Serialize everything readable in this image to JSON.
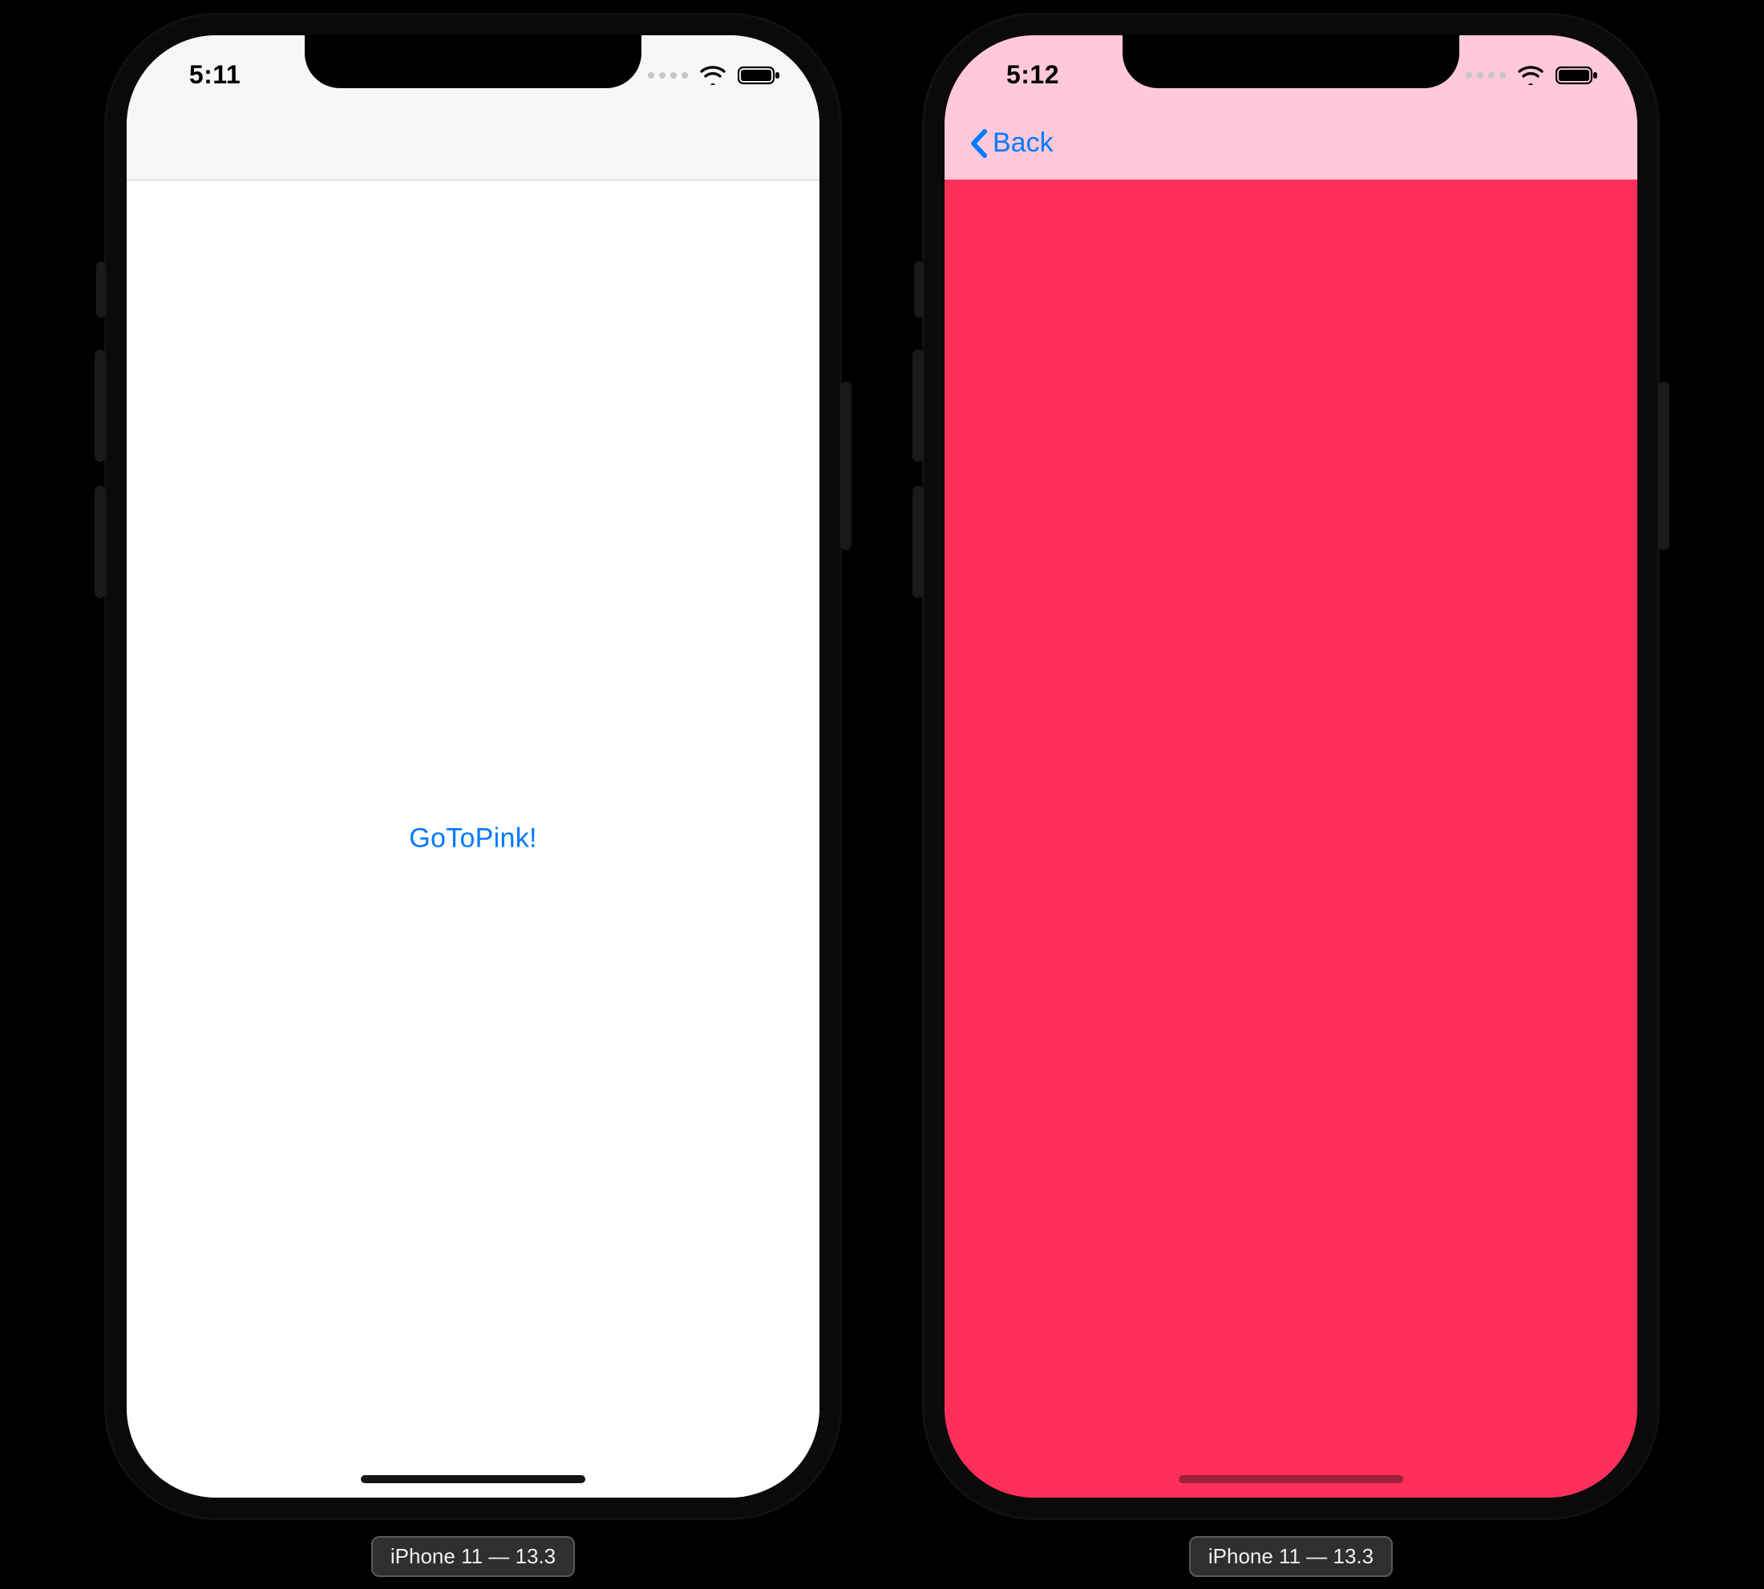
{
  "ios_blue": "#007aff",
  "pink_body": "#ff2f5b",
  "pink_navbar": "#ffc9da",
  "white_navbar": "#f7f7f8",
  "left": {
    "status_time": "5:11",
    "content_button": "GoToPink!",
    "sim_label": "iPhone 11 — 13.3"
  },
  "right": {
    "status_time": "5:12",
    "back_label": "Back",
    "sim_label": "iPhone 11 — 13.3"
  },
  "icons": {
    "cellular": "cellular-signal-weak",
    "wifi": "wifi-icon",
    "battery": "battery-full-icon",
    "chevron_left": "chevron-left-icon"
  }
}
